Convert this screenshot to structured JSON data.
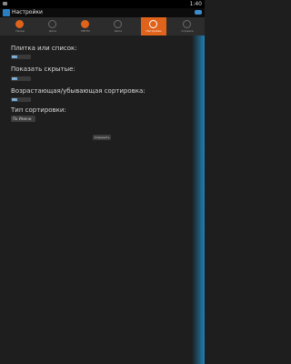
{
  "status_bar": {
    "time": "1:40"
  },
  "header": {
    "title": "Настройки"
  },
  "tabs": [
    {
      "label": "Назад",
      "icon": "back-icon"
    },
    {
      "label": "Дела",
      "icon": "tasks-icon"
    },
    {
      "label": "МЕНЮ",
      "icon": "home-icon"
    },
    {
      "label": "Шаги",
      "icon": "steps-icon"
    },
    {
      "label": "Настройки",
      "icon": "settings-icon",
      "active": true
    },
    {
      "label": "Справка",
      "icon": "help-icon"
    }
  ],
  "settings": {
    "tile_or_list": {
      "label": "Плитка или список:",
      "switch_text": "Off"
    },
    "show_hidden": {
      "label": "Показать скрытые:",
      "switch_text": "Off"
    },
    "asc_desc": {
      "label": "Возрастающая/убывающая сортировка:",
      "switch_text": "Off"
    },
    "sort_type": {
      "label": "Тип сортировки:",
      "value": "По Имени"
    }
  },
  "save_label": "Сохранить",
  "colors": {
    "accent": "#e0631c",
    "switch_blue": "#6aa7d8",
    "edge": "#1f7fb3"
  }
}
